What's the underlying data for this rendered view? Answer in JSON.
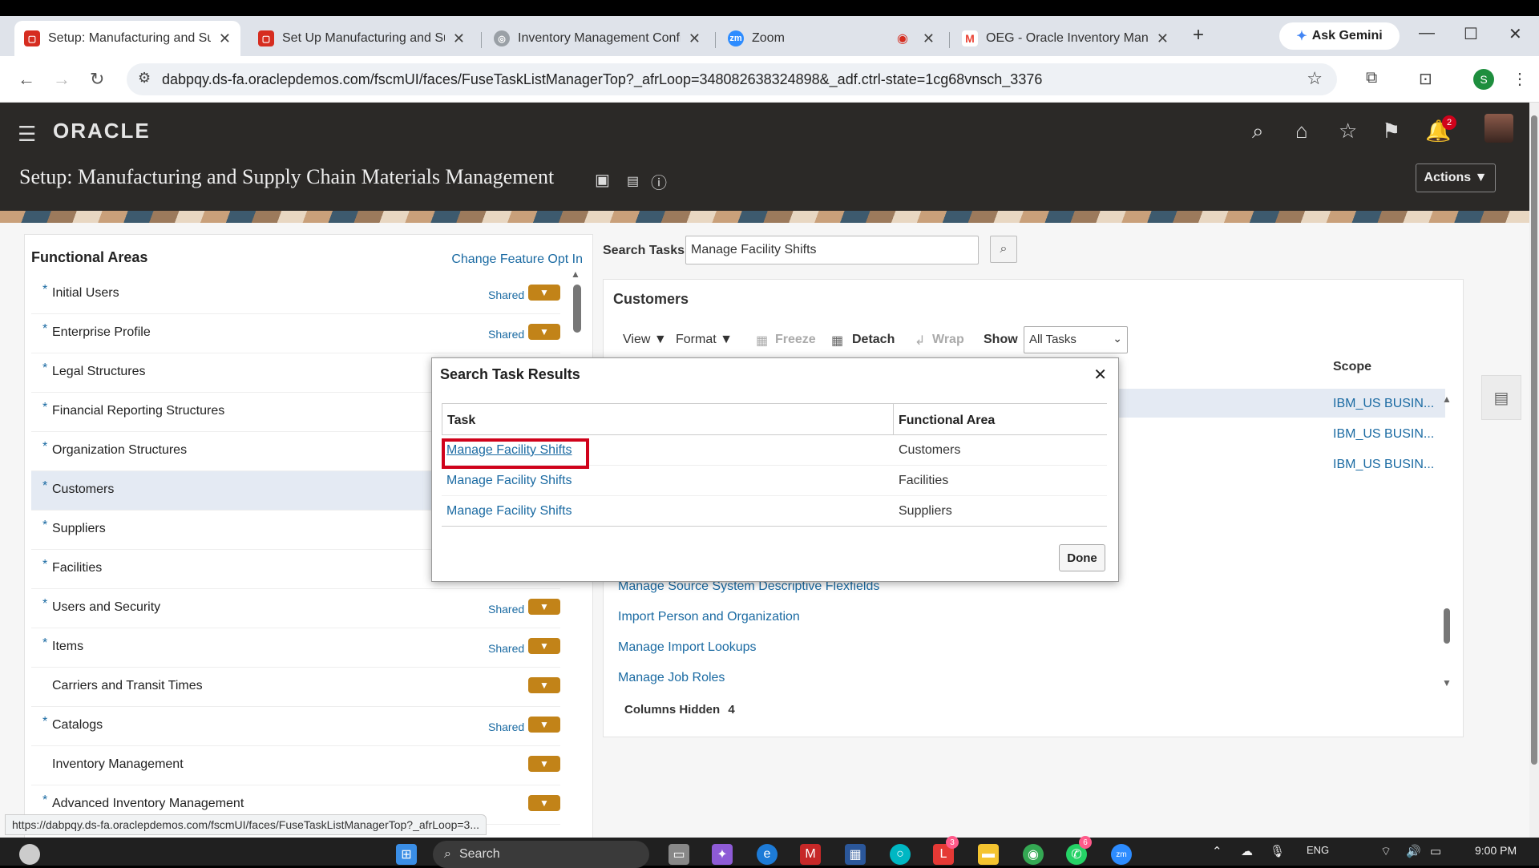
{
  "browser": {
    "tabs": [
      {
        "title": "Setup: Manufacturing and Sup",
        "icon": "oracle-icon",
        "color": "#d62d20"
      },
      {
        "title": "Set Up Manufacturing and Sup",
        "icon": "oracle-icon",
        "color": "#d62d20"
      },
      {
        "title": "Inventory Management Config",
        "icon": "globe-icon",
        "color": "#9aa0a6"
      },
      {
        "title": "Zoom",
        "icon": "zoom-icon",
        "color": "#2d8cff"
      },
      {
        "title": "OEG - Oracle Inventory Manag",
        "icon": "gmail-icon",
        "color": "#ea4335"
      }
    ],
    "new_tab": "+",
    "gemini_label": "Ask Gemini",
    "url": "dabpqy.ds-fa.oraclepdemos.com/fscmUI/faces/FuseTaskListManagerTop?_afrLoop=348082638324898&_adf.ctrl-state=1cg68vnsch_3376",
    "profile_initial": "S"
  },
  "header": {
    "logo": "ORACLE",
    "notification_count": "2",
    "page_title": "Setup: Manufacturing and Supply Chain Materials Management",
    "actions_label": "Actions ▼"
  },
  "functional_areas": {
    "title": "Functional Areas",
    "change_opt_in": "Change Feature Opt In",
    "items": [
      {
        "label": "Initial Users",
        "required": "*",
        "shared": "Shared"
      },
      {
        "label": "Enterprise Profile",
        "required": "*",
        "shared": "Shared"
      },
      {
        "label": "Legal Structures",
        "required": "*",
        "shared": ""
      },
      {
        "label": "Financial Reporting Structures",
        "required": "*",
        "shared": ""
      },
      {
        "label": "Organization Structures",
        "required": "*",
        "shared": ""
      },
      {
        "label": "Customers",
        "required": "*",
        "shared": ""
      },
      {
        "label": "Suppliers",
        "required": "*",
        "shared": ""
      },
      {
        "label": "Facilities",
        "required": "*",
        "shared": ""
      },
      {
        "label": "Users and Security",
        "required": "*",
        "shared": "Shared"
      },
      {
        "label": "Items",
        "required": "*",
        "shared": "Shared"
      },
      {
        "label": "Carriers and Transit Times",
        "required": "",
        "shared": ""
      },
      {
        "label": "Catalogs",
        "required": "*",
        "shared": "Shared"
      },
      {
        "label": "Inventory Management",
        "required": "",
        "shared": ""
      },
      {
        "label": "Advanced Inventory Management",
        "required": "*",
        "shared": ""
      }
    ]
  },
  "search": {
    "label": "Search Tasks",
    "value": "Manage Facility Shifts"
  },
  "customers": {
    "title": "Customers",
    "toolbar": {
      "view": "View ▼",
      "format": "Format ▼",
      "freeze": "Freeze",
      "detach": "Detach",
      "wrap": "Wrap",
      "show": "Show",
      "show_value": "All Tasks"
    },
    "scope_header": "Scope",
    "scope_values": [
      "IBM_US BUSIN...",
      "IBM_US BUSIN...",
      "IBM_US BUSIN..."
    ],
    "task_links": [
      "Manage Source System Descriptive Flexfields",
      "Import Person and Organization",
      "Manage Import Lookups",
      "Manage Job Roles"
    ],
    "columns_hidden_label": "Columns Hidden",
    "columns_hidden_count": "4"
  },
  "modal": {
    "title": "Search Task Results",
    "col_task": "Task",
    "col_area": "Functional Area",
    "rows": [
      {
        "task": "Manage Facility Shifts",
        "area": "Customers"
      },
      {
        "task": "Manage Facility Shifts",
        "area": "Facilities"
      },
      {
        "task": "Manage Facility Shifts",
        "area": "Suppliers"
      }
    ],
    "done_label": "Done"
  },
  "status_url": "https://dabpqy.ds-fa.oraclepdemos.com/fscmUI/faces/FuseTaskListManagerTop?_afrLoop=3...",
  "taskbar": {
    "search_label": "Search",
    "lang": "ENG",
    "time": "9:00 PM",
    "badges": [
      "3",
      "6"
    ]
  }
}
